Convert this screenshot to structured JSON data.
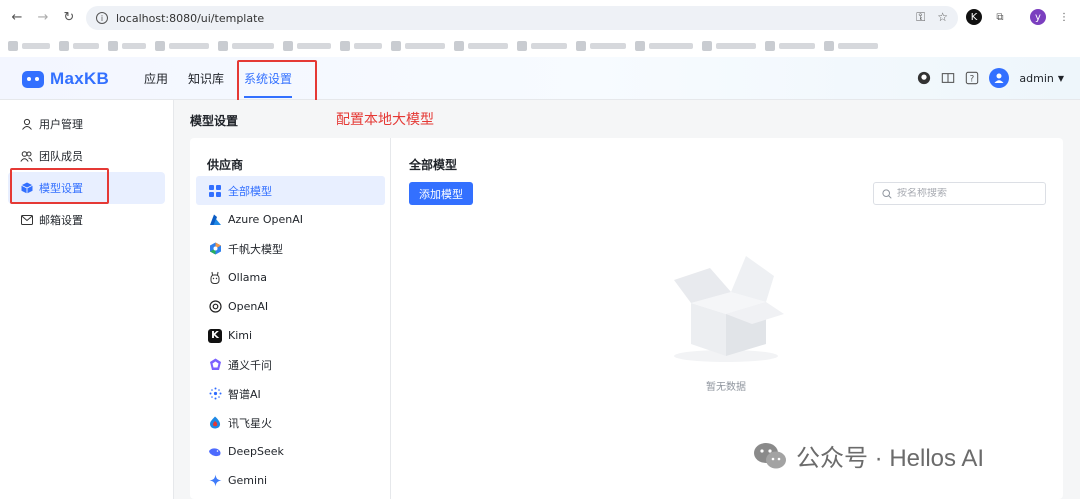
{
  "browser": {
    "url": "localhost:8080/ui/template",
    "profile_initial": "y"
  },
  "app": {
    "logo_text": "MaxKB",
    "nav": [
      {
        "label": "应用"
      },
      {
        "label": "知识库"
      },
      {
        "label": "系统设置",
        "active": true
      }
    ],
    "user_name": "admin"
  },
  "sidebar": {
    "items": [
      {
        "label": "用户管理",
        "icon": "user-icon"
      },
      {
        "label": "团队成员",
        "icon": "team-icon"
      },
      {
        "label": "模型设置",
        "icon": "cube-icon",
        "active": true
      },
      {
        "label": "邮箱设置",
        "icon": "mail-icon"
      }
    ]
  },
  "main": {
    "title": "模型设置",
    "annotation": "配置本地大模型"
  },
  "providers": {
    "title": "供应商",
    "items": [
      {
        "label": "全部模型",
        "icon": "grid-icon",
        "active": true
      },
      {
        "label": "Azure OpenAI",
        "icon": "azure-icon"
      },
      {
        "label": "千帆大模型",
        "icon": "qianfan-icon"
      },
      {
        "label": "Ollama",
        "icon": "ollama-icon"
      },
      {
        "label": "OpenAI",
        "icon": "openai-icon"
      },
      {
        "label": "Kimi",
        "icon": "kimi-icon"
      },
      {
        "label": "通义千问",
        "icon": "tongyi-icon"
      },
      {
        "label": "智谱AI",
        "icon": "zhipu-icon"
      },
      {
        "label": "讯飞星火",
        "icon": "xunfei-icon"
      },
      {
        "label": "DeepSeek",
        "icon": "deepseek-icon"
      },
      {
        "label": "Gemini",
        "icon": "gemini-icon"
      }
    ]
  },
  "content": {
    "title": "全部模型",
    "add_button": "添加模型",
    "search_placeholder": "按名称搜索",
    "empty_text": "暂无数据"
  },
  "watermark": {
    "text": "公众号 · Hellos AI"
  }
}
